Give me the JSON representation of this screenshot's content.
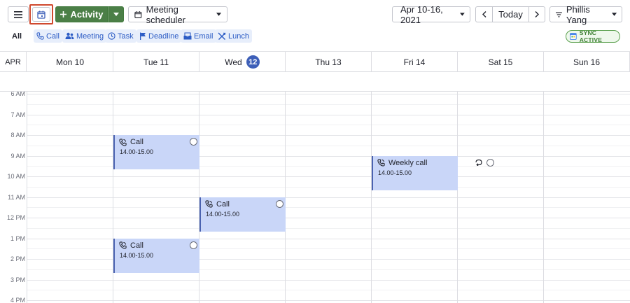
{
  "toolbar": {
    "activity_label": "Activity",
    "scheduler_label": "Meeting scheduler",
    "date_range": "Apr 10-16, 2021",
    "today_label": "Today",
    "user_name": "Phillis Yang"
  },
  "filters": {
    "all_label": "All",
    "chips": [
      {
        "label": "Call",
        "icon": "phone-icon"
      },
      {
        "label": "Meeting",
        "icon": "people-icon"
      },
      {
        "label": "Task",
        "icon": "clock-icon"
      },
      {
        "label": "Deadline",
        "icon": "flag-icon"
      },
      {
        "label": "Email",
        "icon": "envelope-icon"
      },
      {
        "label": "Lunch",
        "icon": "utensils-icon"
      }
    ],
    "sync_label": "SYNC ACTIVE"
  },
  "calendar": {
    "month": "APR",
    "days": [
      {
        "label": "Mon 10"
      },
      {
        "label": "Tue 11"
      },
      {
        "label": "Wed",
        "num": "12",
        "today": true
      },
      {
        "label": "Thu 13"
      },
      {
        "label": "Fri 14"
      },
      {
        "label": "Sat 15"
      },
      {
        "label": "Sun 16"
      }
    ],
    "hours": [
      "6 AM",
      "7 AM",
      "8 AM",
      "9 AM",
      "10 AM",
      "11 AM",
      "12 PM",
      "1 PM",
      "2 PM",
      "3 PM",
      "4 PM"
    ],
    "events": [
      {
        "day": 1,
        "start": 8,
        "end": 9.67,
        "title": "Call",
        "time": "14.00-15.00"
      },
      {
        "day": 4,
        "start": 9,
        "end": 10.67,
        "title": "Weekly call",
        "time": "14.00-15.00"
      },
      {
        "day": 2,
        "start": 11,
        "end": 12.67,
        "title": "Call",
        "time": "14.00-15.00"
      },
      {
        "day": 1,
        "start": 13,
        "end": 14.67,
        "title": "Call",
        "time": "14.00-15.00"
      }
    ]
  },
  "colors": {
    "accent": "#3d5fb8",
    "event_bg": "#c9d6f8",
    "activity_green": "#4b7f47",
    "highlight_border": "#d0492e"
  }
}
